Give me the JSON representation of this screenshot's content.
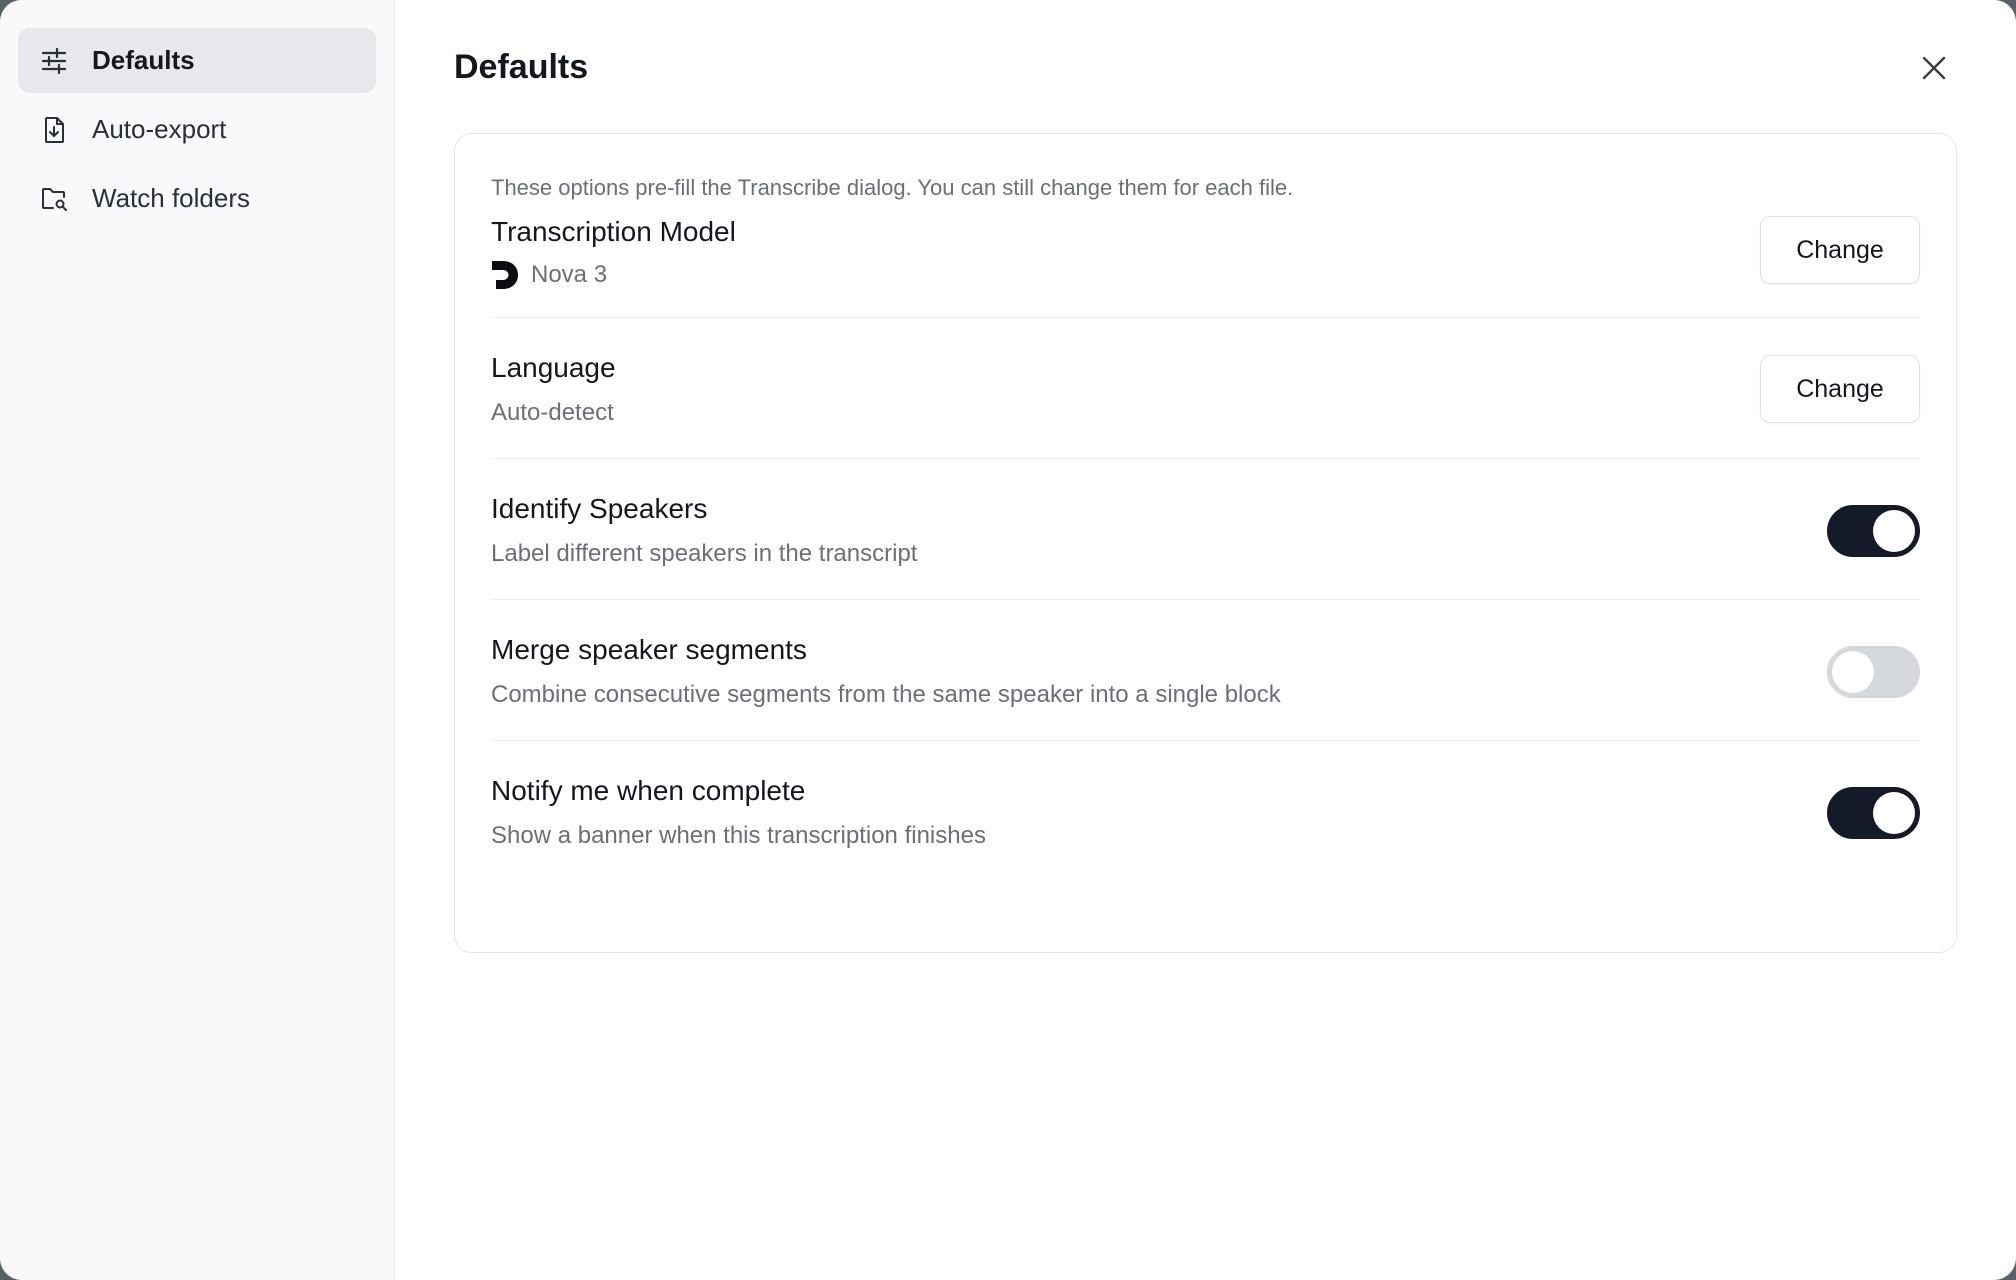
{
  "sidebar": {
    "items": [
      {
        "label": "Defaults",
        "icon": "sliders-icon",
        "active": true
      },
      {
        "label": "Auto-export",
        "icon": "file-download-icon",
        "active": false
      },
      {
        "label": "Watch folders",
        "icon": "folder-search-icon",
        "active": false
      }
    ]
  },
  "main": {
    "title": "Defaults",
    "close_icon": "close-icon",
    "intro": "These options pre-fill the Transcribe dialog. You can still change them for each file.",
    "model": {
      "title": "Transcription Model",
      "value": "Nova 3",
      "icon": "deepgram-logo-icon",
      "button": "Change"
    },
    "language": {
      "title": "Language",
      "value": "Auto-detect",
      "button": "Change"
    },
    "identify_speakers": {
      "title": "Identify Speakers",
      "description": "Label different speakers in the transcript",
      "enabled": true
    },
    "merge_segments": {
      "title": "Merge speaker segments",
      "description": "Combine consecutive segments from the same speaker into a single block",
      "enabled": false
    },
    "notify": {
      "title": "Notify me when complete",
      "description": "Show a banner when this transcription finishes",
      "enabled": true
    }
  },
  "colors": {
    "toggle_on": "#141a27",
    "toggle_off": "#d5d8dd",
    "sidebar_bg": "#f8f9fb",
    "active_item_bg": "#e7e8eb"
  }
}
